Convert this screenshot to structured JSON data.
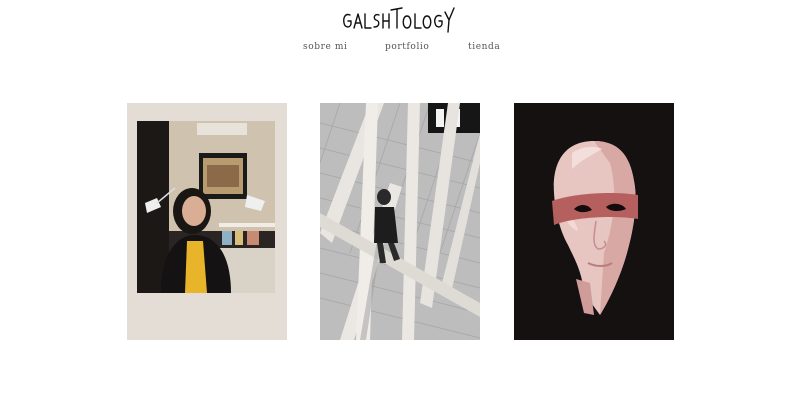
{
  "site": {
    "logo_text": "GALSHTOLOGY"
  },
  "nav": {
    "items": [
      {
        "label": "sobre mi"
      },
      {
        "label": "portfolio"
      },
      {
        "label": "tienda"
      }
    ]
  },
  "gallery": {
    "items": [
      {
        "kind": "polaroid-portrait",
        "caption": ""
      },
      {
        "kind": "staircase-photo",
        "caption": ""
      },
      {
        "kind": "masked-face-illustration",
        "caption": ""
      }
    ]
  },
  "colors": {
    "nav_text": "#555555",
    "accent_yellow": "#e8b52a",
    "mask_red": "#b5605e",
    "dark_bg": "#151111"
  }
}
